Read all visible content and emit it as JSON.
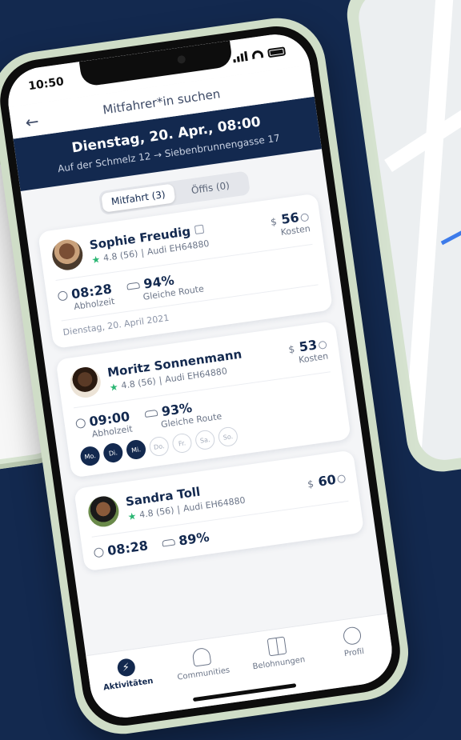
{
  "status_bar": {
    "time": "10:50"
  },
  "nav": {
    "title": "Mitfahrer*in suchen",
    "back_icon": "arrow-left-icon"
  },
  "header": {
    "title": "Dienstag, 20. Apr., 08:00",
    "route": "Auf der Schmelz 12 → Siebenbrunnengasse 17"
  },
  "segments": [
    {
      "label": "Mitfahrt (3)",
      "active": true
    },
    {
      "label": "Öffis (0)",
      "active": false
    }
  ],
  "offers": [
    {
      "name": "Sophie Freudig",
      "rating": "4.8 (56)",
      "separator": "|",
      "car": "Audi EH64880",
      "currency": "$",
      "price": "56",
      "price_label": "Kosten",
      "time": "08:28",
      "time_label": "Abholzeit",
      "match": "94%",
      "match_label": "Gleiche Route",
      "date": "Dienstag, 20. April 2021"
    },
    {
      "name": "Moritz Sonnenmann",
      "rating": "4.8 (56)",
      "separator": "|",
      "car": "Audi EH64880",
      "currency": "$",
      "price": "53",
      "price_label": "Kosten",
      "time": "09:00",
      "time_label": "Abholzeit",
      "match": "93%",
      "match_label": "Gleiche Route",
      "days": [
        "Mo.",
        "Di.",
        "Mi.",
        "Do.",
        "Fr.",
        "Sa.",
        "So."
      ]
    },
    {
      "name": "Sandra Toll",
      "rating": "4.8 (56)",
      "separator": "|",
      "car": "Audi EH64880",
      "currency": "$",
      "price": "60",
      "time": "08:28",
      "match": "89%"
    }
  ],
  "tabs": [
    {
      "label": "Aktivitäten",
      "icon": "bolt-icon"
    },
    {
      "label": "Communities",
      "icon": "people-icon"
    },
    {
      "label": "Belohnungen",
      "icon": "gift-icon"
    },
    {
      "label": "Profil",
      "icon": "profile-icon"
    }
  ],
  "colors": {
    "navy": "#13294f",
    "star": "#2bb673",
    "bezel": "#cfddc7"
  }
}
